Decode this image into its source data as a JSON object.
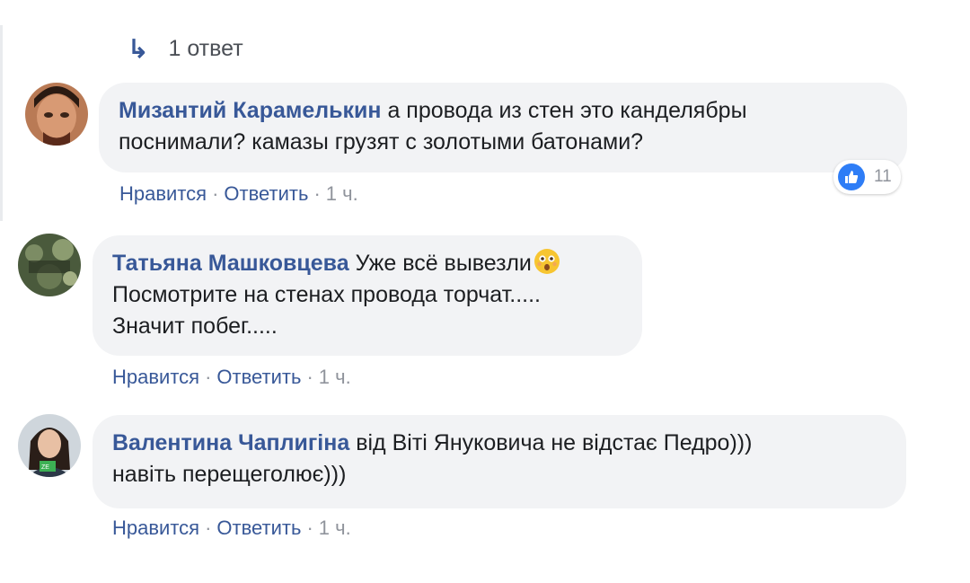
{
  "reply_link": {
    "label": "1 ответ"
  },
  "comments": [
    {
      "author": "Мизантий Карамелькин",
      "text_line1": "а провода из стен это канделябры",
      "text_line2": "поснимали? камазы грузят с золотыми батонами?",
      "like_action": "Нравится",
      "reply_action": "Ответить",
      "time": "1 ч.",
      "reaction_count": "11"
    },
    {
      "author": "Татьяна Машковцева",
      "text_line1": "Уже всё вывезли",
      "text_line2": "Посмотрите на стенах провода торчат.....",
      "text_line3": "Значит побег.....",
      "emoji": "astonished-face-emoji",
      "like_action": "Нравится",
      "reply_action": "Ответить",
      "time": "1 ч."
    },
    {
      "author": "Валентина Чаплигіна",
      "text_line1": "від Віті Януковича не відстає Педро)))",
      "text_line2": "навіть перещеголює)))",
      "like_action": "Нравится",
      "reply_action": "Ответить",
      "time": "1 ч."
    }
  ],
  "separator": "·",
  "colors": {
    "author": "#385898",
    "bubble": "#f2f3f5",
    "meta": "#90949c",
    "like": "#2e7df6"
  }
}
